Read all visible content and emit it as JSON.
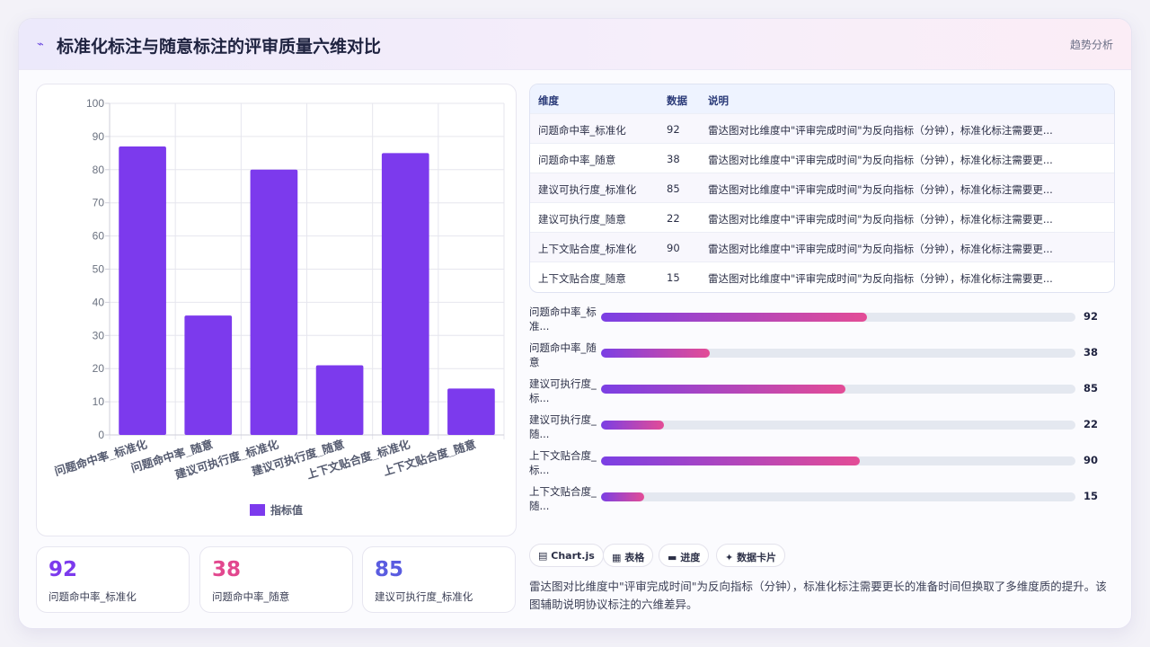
{
  "header": {
    "icon": "pulse-icon",
    "title": "标准化标注与随意标注的评审质量六维对比",
    "tag": "趋势分析"
  },
  "chart_data": {
    "type": "bar",
    "categories": [
      "问题命中率_标准化",
      "问题命中率_随意",
      "建议可执行度_标准化",
      "建议可执行度_随意",
      "上下文贴合度_标准化",
      "上下文贴合度_随意"
    ],
    "series": [
      {
        "name": "指标值",
        "values": [
          87,
          36,
          80,
          21,
          85,
          14
        ]
      }
    ],
    "ylim": [
      0,
      100
    ],
    "yticks": [
      "100",
      "90",
      "80",
      "70",
      "60",
      "50",
      "40",
      "30",
      "20",
      "10",
      "0"
    ],
    "bar_color": "#7c3aed",
    "grid": true,
    "legend": "bottom"
  },
  "stats": [
    {
      "value": "92",
      "label": "问题命中率_标准化",
      "color": "#7c3aed"
    },
    {
      "value": "38",
      "label": "问题命中率_随意",
      "color": "#e2478e"
    },
    {
      "value": "85",
      "label": "建议可执行度_标准化",
      "color": "#5a5ce0"
    }
  ],
  "table": {
    "headers": [
      "维度",
      "数据",
      "说明"
    ],
    "rows": [
      [
        "问题命中率_标准化",
        "92",
        "雷达图对比维度中\"评审完成时间\"为反向指标（分钟），标准化标注需要更..."
      ],
      [
        "问题命中率_随意",
        "38",
        "雷达图对比维度中\"评审完成时间\"为反向指标（分钟），标准化标注需要更..."
      ],
      [
        "建议可执行度_标准化",
        "85",
        "雷达图对比维度中\"评审完成时间\"为反向指标（分钟），标准化标注需要更..."
      ],
      [
        "建议可执行度_随意",
        "22",
        "雷达图对比维度中\"评审完成时间\"为反向指标（分钟），标准化标注需要更..."
      ],
      [
        "上下文贴合度_标准化",
        "90",
        "雷达图对比维度中\"评审完成时间\"为反向指标（分钟），标准化标注需要更..."
      ],
      [
        "上下文贴合度_随意",
        "15",
        "雷达图对比维度中\"评审完成时间\"为反向指标（分钟），标准化标注需要更..."
      ]
    ]
  },
  "progress": [
    {
      "label": "问题命中率_标准...",
      "value": "92",
      "fraction": 0.56
    },
    {
      "label": "问题命中率_随意",
      "value": "38",
      "fraction": 0.23
    },
    {
      "label": "建议可执行度_标...",
      "value": "85",
      "fraction": 0.515
    },
    {
      "label": "建议可执行度_随...",
      "value": "22",
      "fraction": 0.133
    },
    {
      "label": "上下文贴合度_标...",
      "value": "90",
      "fraction": 0.545
    },
    {
      "label": "上下文贴合度_随...",
      "value": "15",
      "fraction": 0.091
    }
  ],
  "chips": [
    {
      "icon": "chart-icon",
      "glyph": "▤",
      "label": "Chart.js"
    },
    {
      "icon": "table-icon",
      "glyph": "▦",
      "label": "表格"
    },
    {
      "icon": "progress-icon",
      "glyph": "▬",
      "label": "进度"
    },
    {
      "icon": "sparkle-icon",
      "glyph": "✦",
      "label": "数据卡片"
    }
  ],
  "note": "雷达图对比维度中\"评审完成时间\"为反向指标（分钟），标准化标注需要更长的准备时间但换取了多维度质的提升。该图辅助说明协议标注的六维差异。"
}
